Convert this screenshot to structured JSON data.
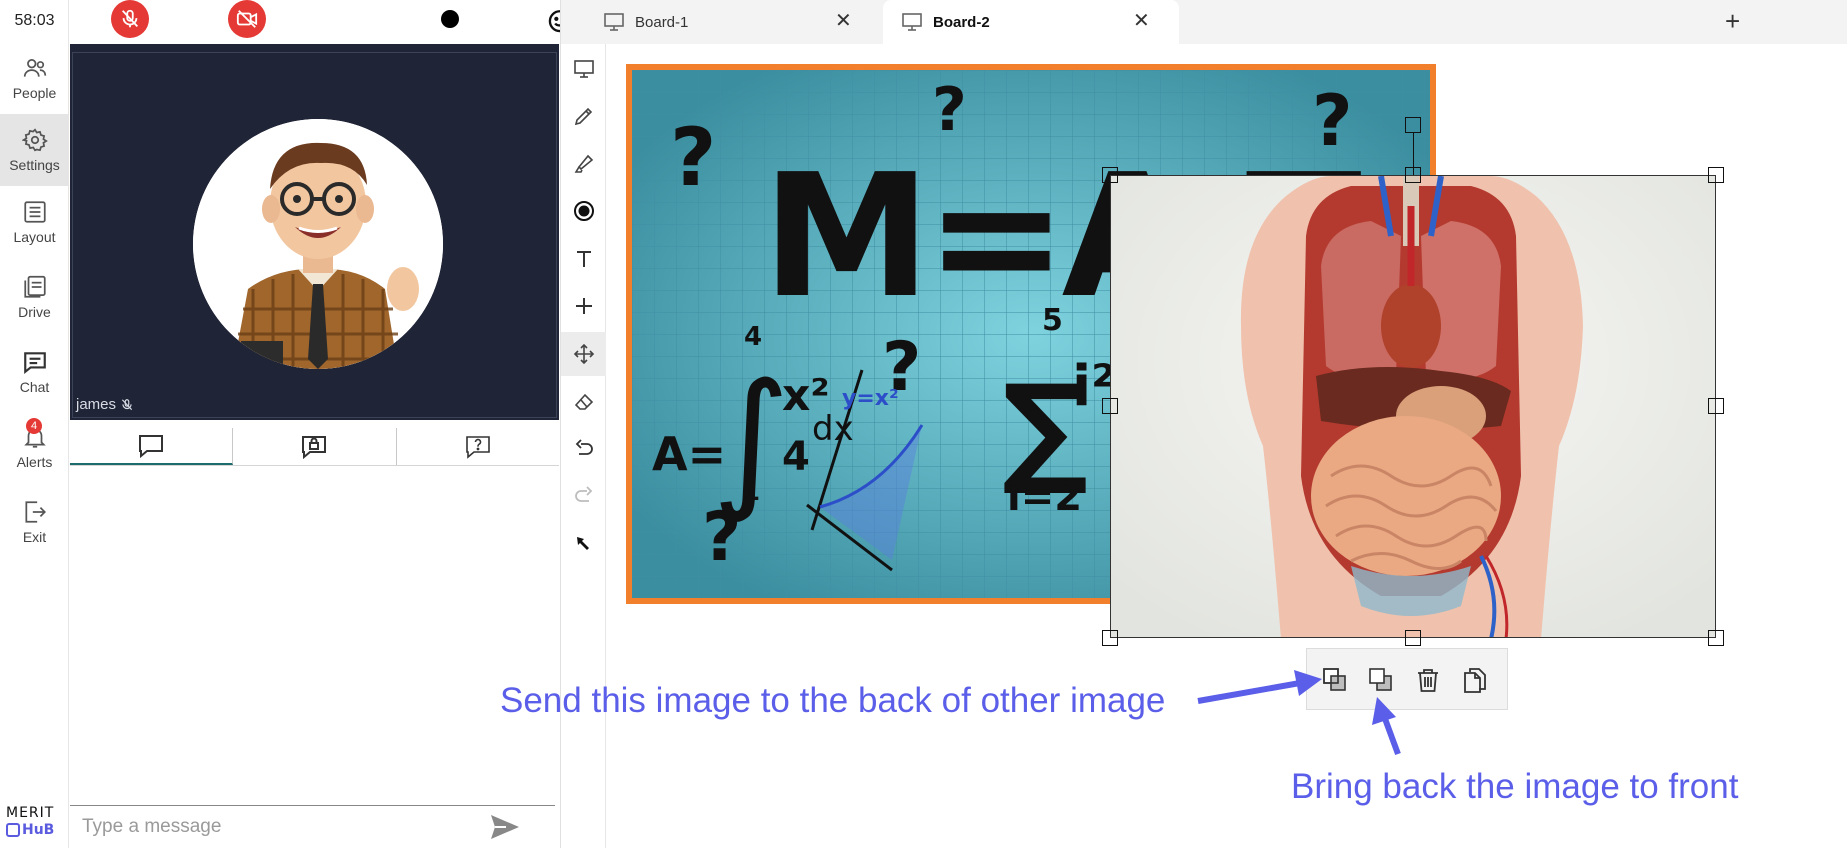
{
  "timer": "58:03",
  "nav": {
    "items": [
      {
        "label": "People",
        "icon": "people-icon"
      },
      {
        "label": "Settings",
        "icon": "gear-icon"
      },
      {
        "label": "Layout",
        "icon": "layout-icon"
      },
      {
        "label": "Drive",
        "icon": "drive-icon"
      },
      {
        "label": "Chat",
        "icon": "chat-icon"
      },
      {
        "label": "Alerts",
        "icon": "bell-icon",
        "badge": "4"
      },
      {
        "label": "Exit",
        "icon": "exit-icon"
      }
    ],
    "active": "Settings",
    "logo_line1": "MERIT",
    "logo_line2": "HuB"
  },
  "controls": {
    "mic": "mic-off-icon",
    "camera": "camera-off-icon",
    "record": "record-icon",
    "reactions": "emoji-add-icon"
  },
  "video": {
    "participant_name": "james",
    "muted_icon": "mic-off-icon"
  },
  "chat": {
    "tabs": [
      "chat-bubble-icon",
      "private-chat-icon",
      "question-icon"
    ],
    "placeholder": "Type a message"
  },
  "boards": {
    "tabs": [
      {
        "label": "Board-1",
        "active": false
      },
      {
        "label": "Board-2",
        "active": true
      }
    ],
    "add_label": "+"
  },
  "tools": [
    "presentation-icon",
    "pencil-icon",
    "highlighter-icon",
    "shape-icon",
    "text-icon",
    "plus-icon",
    "move-icon",
    "eraser-icon",
    "undo-icon",
    "redo-icon",
    "pointer-icon"
  ],
  "active_tool": "move-icon",
  "image_toolbar": [
    "send-backward-icon",
    "bring-forward-icon",
    "trash-icon",
    "duplicate-icon"
  ],
  "annotations": {
    "send_back": "Send this image to the back of other image",
    "bring_front": "Bring back the image to front"
  },
  "colors": {
    "accent": "#5a5ee8",
    "danger": "#e53935",
    "video_bg": "#1f2436",
    "math_frame": "#f17f2c",
    "math_bg": "#5cb6c7"
  }
}
